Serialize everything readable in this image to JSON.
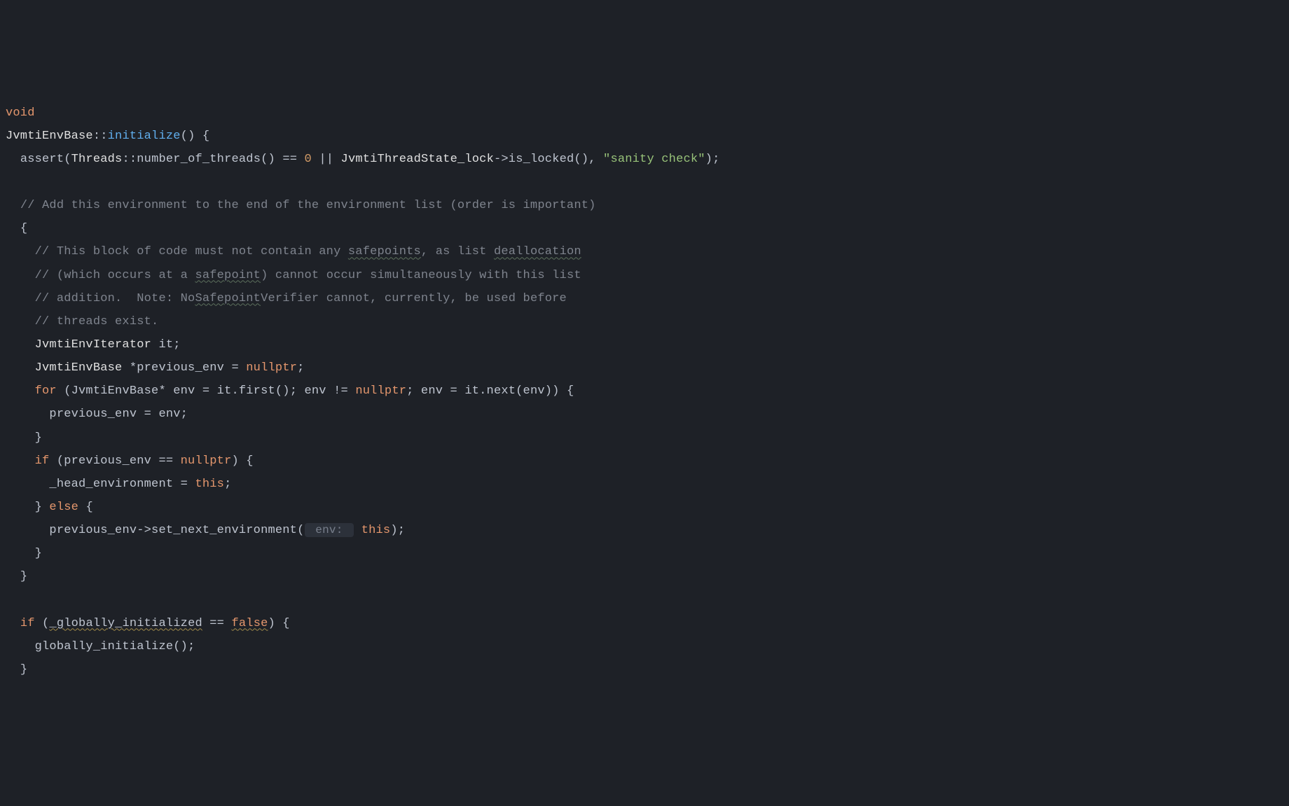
{
  "t": {
    "void": "void",
    "class": "JvmtiEnvBase",
    "scope": "::",
    "initFn": "initialize",
    "parenOpen": "()",
    "braceOpen": " {",
    "assert": "assert",
    "threads": "Threads",
    "numThreads": "number_of_threads",
    "eqeq0": " == ",
    "zero": "0",
    "oror": " || ",
    "jvmtiLock": "JvmtiThreadState_lock",
    "arrow": "->",
    "isLocked": "is_locked",
    "sanity": "\"sanity check\"",
    "cmt1": "// Add this environment to the end of the environment list (order is important)",
    "cmt2a": "// This block of code must not contain any ",
    "sq_safepoints": "safepoints",
    "cmt2b": ", as list ",
    "sq_dealloc": "deallocation",
    "cmt3a": "// (which occurs at a ",
    "sq_safepoint": "safepoint",
    "cmt3b": ") cannot occur simultaneously with this list",
    "cmt4a": "// addition.  Note: No",
    "sq_Safepoint": "Safepoint",
    "cmt4b": "Verifier cannot, currently, be used before",
    "cmt5": "// threads exist.",
    "iter": "JvmtiEnvIterator",
    "it": " it",
    "base": "JvmtiEnvBase",
    "prevEnv": " *previous_env = ",
    "nullptr": "nullptr",
    "for": "for",
    "forHead": " (JvmtiEnvBase* env = it.",
    "first": "first",
    "forMid": "(); env != ",
    "forEnd": "; env = it.",
    "next": "next",
    "nextArg": "(env)) {",
    "assignPrev": "previous_env = env;",
    "rbrace": "}",
    "if": "if",
    "ifCond": " (previous_env == ",
    "ifCondEnd": ") {",
    "headEnv": "_head_environment = ",
    "this": "this",
    "semi": ";",
    "else": " else ",
    "prevArrowSet": "previous_env->",
    "setNextEnv": "set_next_environment",
    "hint_env": " env: ",
    "if2a": " (",
    "globInit": "_globally_initialized",
    "if2b": " == ",
    "false": "false",
    "globInitFn": "globally_initialize",
    "emptyParenSemi": "();",
    "openParen": "(",
    "commaSep": ", ",
    "closeParenSemi": ");",
    "closeParenBrace": ") {",
    "lbrace": "{"
  }
}
